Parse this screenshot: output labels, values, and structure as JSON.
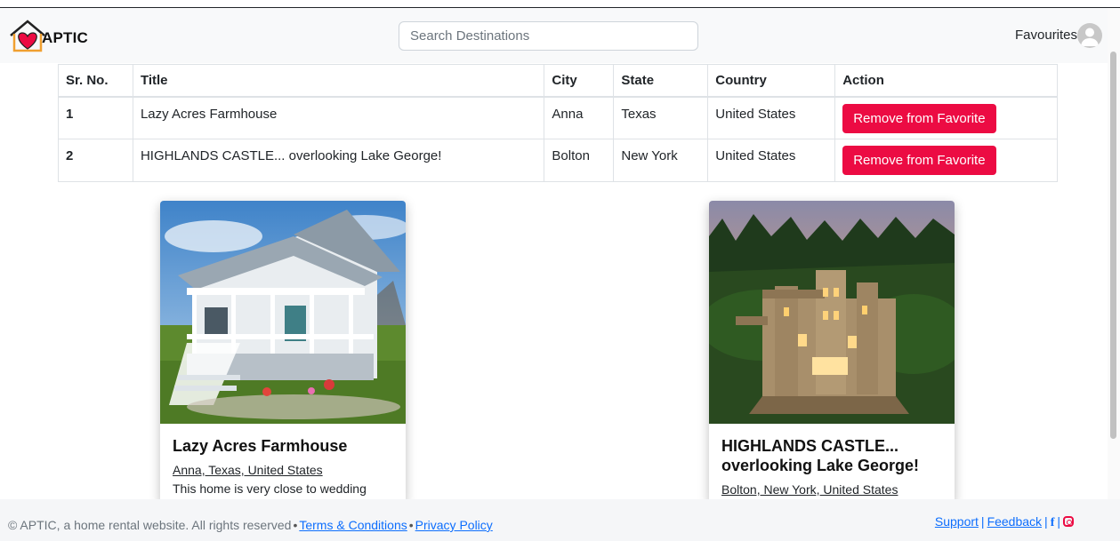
{
  "brand": {
    "name": "APTIC",
    "accent": "#ec0b43"
  },
  "navbar": {
    "search_placeholder": "Search Destinations",
    "favourites_label": "Favourites",
    "avatar_icon": "user-circle-icon"
  },
  "table": {
    "headers": {
      "no": "Sr. No.",
      "title": "Title",
      "city": "City",
      "state": "State",
      "country": "Country",
      "action": "Action"
    },
    "rows": [
      {
        "no": "1",
        "title": "Lazy Acres Farmhouse",
        "city": "Anna",
        "state": "Texas",
        "country": "United States",
        "action": "Remove from Favorite"
      },
      {
        "no": "2",
        "title": "HIGHLANDS CASTLE... overlooking Lake George!",
        "city": "Bolton",
        "state": "New York",
        "country": "United States",
        "action": "Remove from Favorite"
      }
    ]
  },
  "cards": [
    {
      "title": "Lazy Acres Farmhouse",
      "location": "Anna, Texas, United States",
      "description": "This home is very close to wedding"
    },
    {
      "title": "HIGHLANDS CASTLE... overlooking Lake George!",
      "location": "Bolton, New York, United States"
    }
  ],
  "footer": {
    "copyright": "© APTIC, a home rental website. All rights reserved",
    "terms": "Terms & Conditions",
    "privacy": "Privacy Policy",
    "support": "Support",
    "feedback": "Feedback",
    "facebook": "f"
  }
}
